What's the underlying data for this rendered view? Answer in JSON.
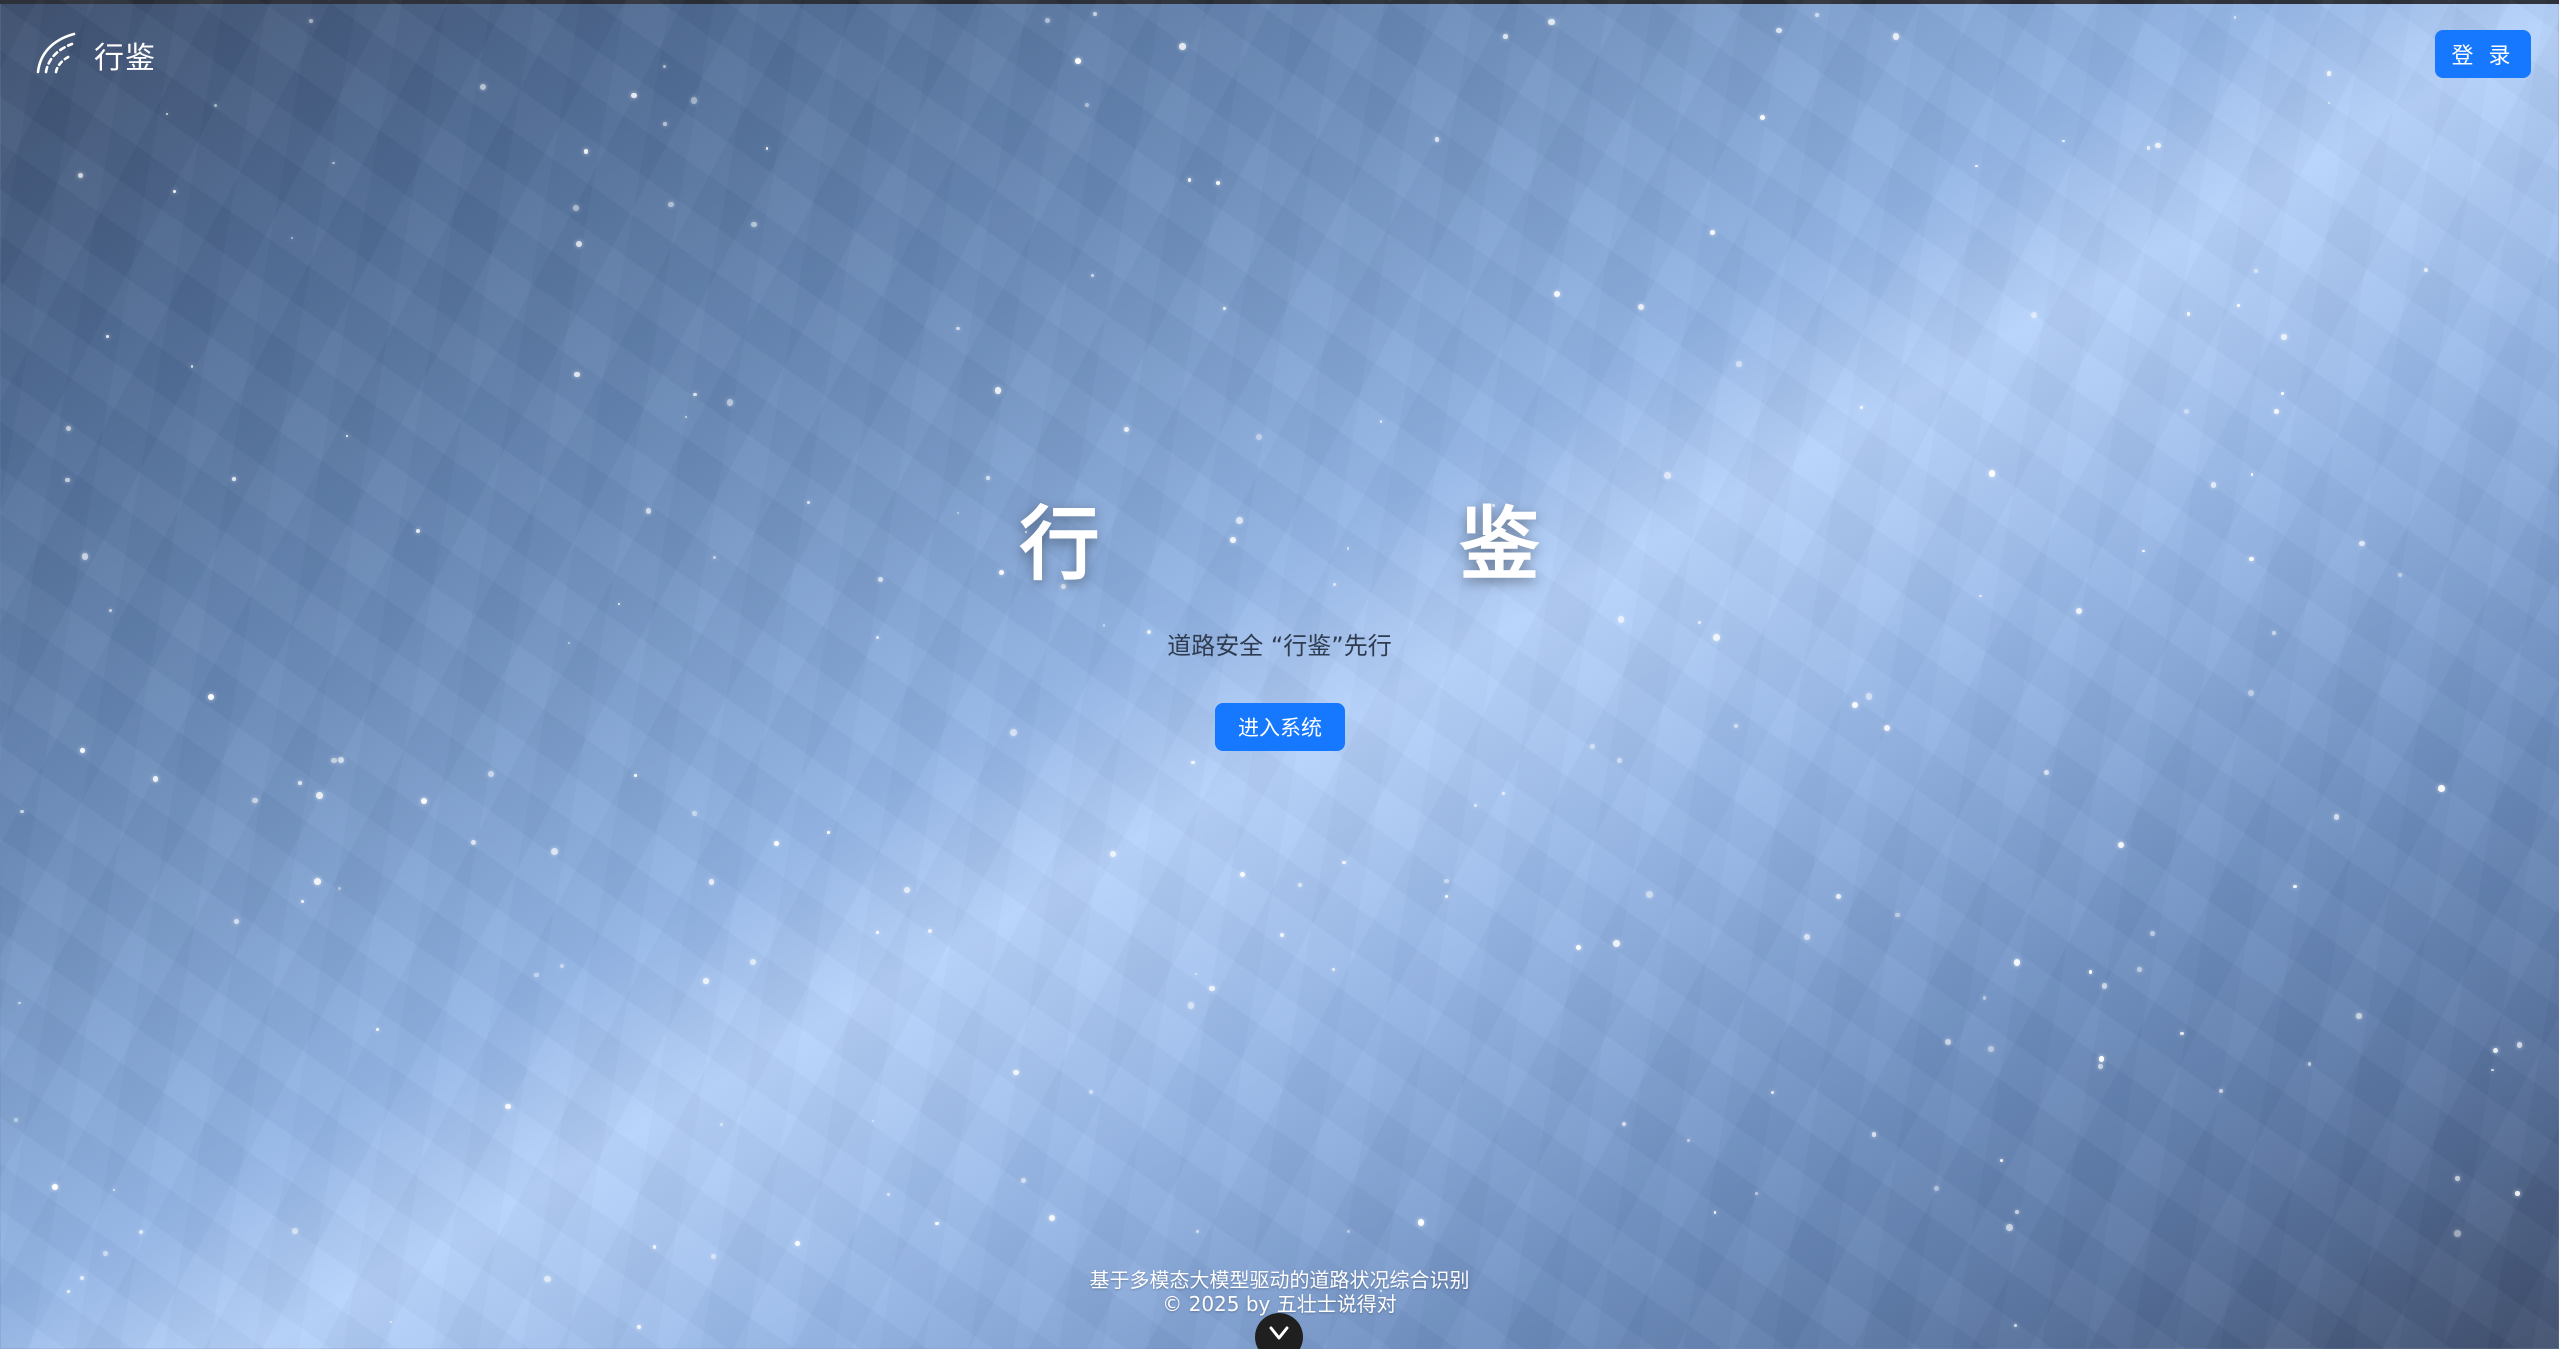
{
  "header": {
    "logo_text": "行鉴",
    "logo_icon": "road-speed-icon",
    "login_label": "登 录"
  },
  "hero": {
    "title_left": "行",
    "title_right": "鉴",
    "subtitle": "道路安全 “行鉴”先行",
    "enter_label": "进入系统"
  },
  "footer": {
    "line1": "基于多模态大模型驱动的道路状况综合识别",
    "line2": "© 2025 by 五壮士说得对"
  },
  "scroll": {
    "icon": "chevron-down-icon"
  },
  "colors": {
    "primary": "#1677ff",
    "background_dark": "#3d4f6e",
    "background_light": "#b6d2fb"
  }
}
